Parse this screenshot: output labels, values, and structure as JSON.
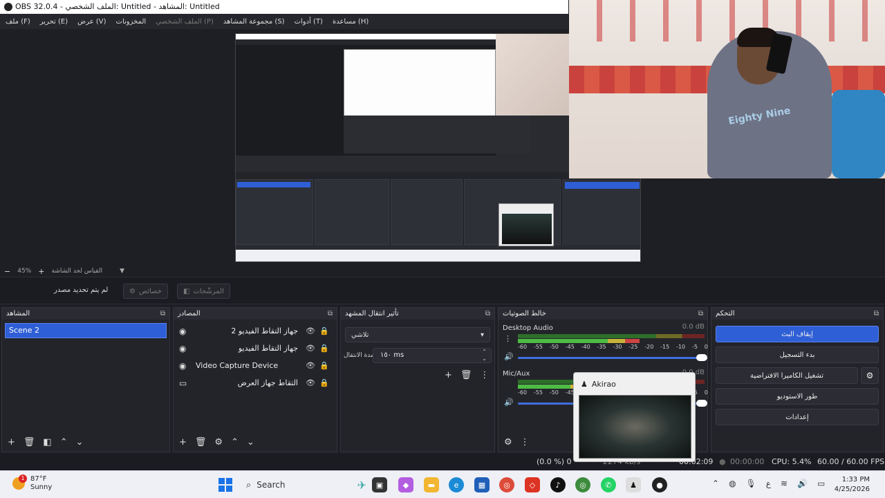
{
  "window": {
    "title": "OBS 32.0.4 - الملف الشخصي: Untitled - المشاهد: Untitled"
  },
  "menu": {
    "items": [
      {
        "label": "ملف (F)",
        "enabled": true
      },
      {
        "label": "تحرير (E)",
        "enabled": true
      },
      {
        "label": "عرض (V)",
        "enabled": true
      },
      {
        "label": "المخزونات",
        "enabled": true
      },
      {
        "label": "الملف الشخصي (P)",
        "enabled": false
      },
      {
        "label": "مجموعة المشاهد (S)",
        "enabled": true
      },
      {
        "label": "أدوات (T)",
        "enabled": true
      },
      {
        "label": "مساعدة (H)",
        "enabled": true
      }
    ]
  },
  "preview": {
    "zoom_label": "45%",
    "zoom_minus": "−",
    "zoom_plus": "+",
    "zoom_caption": "القياس لحد الشاشة"
  },
  "context_bar": {
    "no_source": "لم يتم تحديد مصدر",
    "properties": "خصائص",
    "filters": "المرشّحات"
  },
  "docks": {
    "scenes": {
      "title": "المشاهد",
      "items": [
        "Scene 2"
      ]
    },
    "sources": {
      "title": "المصادر",
      "items": [
        {
          "label": "جهاز التقاط الفيديو 2",
          "type": "camera",
          "ltr": false
        },
        {
          "label": "جهاز التقاط الفيديو",
          "type": "camera",
          "ltr": false
        },
        {
          "label": "Video Capture Device",
          "type": "camera",
          "ltr": true
        },
        {
          "label": "التقاط جهاز العرض",
          "type": "monitor",
          "ltr": false
        }
      ]
    },
    "transitions": {
      "title": "تأثير انتقال المشهد",
      "selected": "تلاشي",
      "duration_label": "مدة الانتقال",
      "duration_value": "١٥٠ ms"
    },
    "mixer": {
      "title": "خالط الصوتيات",
      "ticks": [
        "-60",
        "-55",
        "-50",
        "-45",
        "-40",
        "-35",
        "-30",
        "-25",
        "-20",
        "-15",
        "-10",
        "-5",
        "0"
      ],
      "channels": [
        {
          "name": "Desktop Audio",
          "db": "0.0 dB"
        },
        {
          "name": "Mic/Aux",
          "db": "0.0 dB"
        }
      ]
    },
    "controls": {
      "title": "التحكم",
      "stop_stream": "إيقاف البث",
      "start_recording": "بدء التسجيل",
      "start_virtual_cam": "تشغيل الكاميرا الافتراضية",
      "studio_mode": "طور الاستوديو",
      "settings": "إعدادات"
    }
  },
  "status": {
    "frames": "(0.0 %) 0",
    "bitrate": "2274 kb/s",
    "stream_time": "00:02:09",
    "rec_time": "00:00:00",
    "cpu": "CPU: 5.4%",
    "fps": "60.00 / 60.00 FPS"
  },
  "notification": {
    "app": "Akirao"
  },
  "taskbar": {
    "weather_temp": "87°F",
    "weather_desc": "Sunny",
    "weather_badge": "1",
    "search_label": "Search",
    "time": "1:33 PM",
    "date": "4/25/2026",
    "lang": "ع"
  },
  "webcam": {
    "shirt_text": "Eighty Nine"
  },
  "colors": {
    "accent": "#2f5fd6",
    "panel": "#23242a",
    "bg": "#1e1f24"
  }
}
